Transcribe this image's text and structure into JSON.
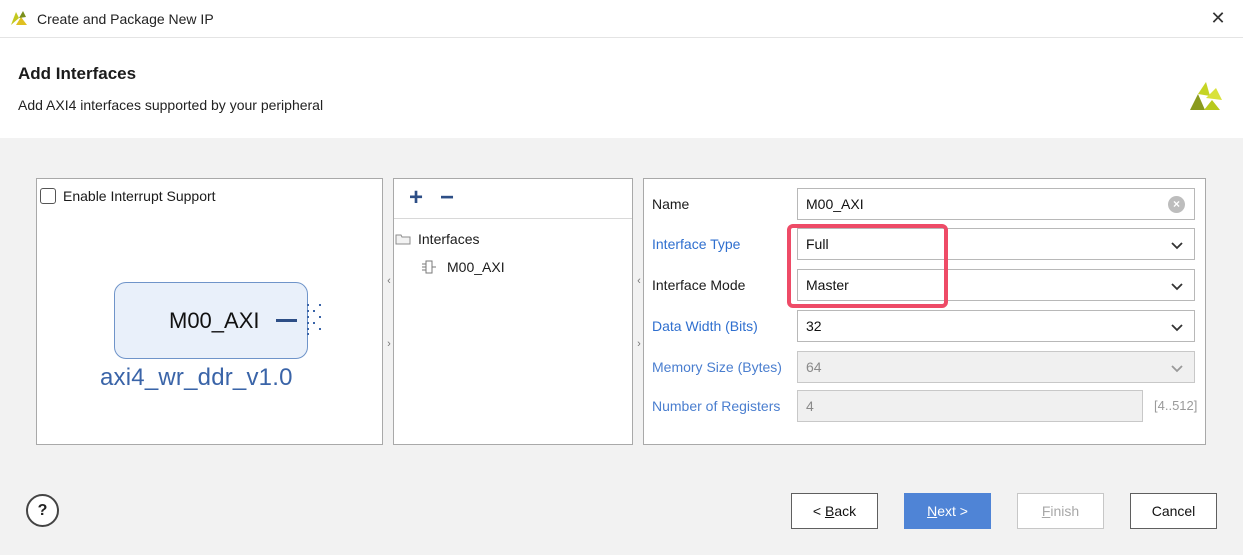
{
  "window": {
    "title": "Create and Package New IP",
    "close_glyph": "✕"
  },
  "header": {
    "title": "Add Interfaces",
    "subtitle": "Add AXI4 interfaces supported by your peripheral"
  },
  "symbol_panel": {
    "interrupt_checkbox_label": "Enable Interrupt Support",
    "interrupt_checked": false,
    "ip_port_label": "M00_AXI",
    "ip_name": "axi4_wr_ddr_v1.0"
  },
  "interface_tree": {
    "add_glyph": "+",
    "remove_glyph": "−",
    "root_label": "Interfaces",
    "items": [
      {
        "label": "M00_AXI"
      }
    ]
  },
  "splitters": {
    "left": "‹",
    "right": "›"
  },
  "properties": {
    "name": {
      "label": "Name",
      "value": "M00_AXI"
    },
    "interface_type": {
      "label": "Interface Type",
      "value": "Full"
    },
    "interface_mode": {
      "label": "Interface Mode",
      "value": "Master"
    },
    "data_width": {
      "label": "Data Width (Bits)",
      "value": "32"
    },
    "memory_size": {
      "label": "Memory Size (Bytes)",
      "value": "64"
    },
    "num_registers": {
      "label": "Number of Registers",
      "value": "4",
      "range": "[4..512]"
    }
  },
  "footer": {
    "help_label": "?",
    "back": {
      "mnemonic": "B",
      "rest": "ack",
      "prefix": "< "
    },
    "next": {
      "mnemonic": "N",
      "rest": "ext >"
    },
    "finish": {
      "mnemonic": "F",
      "rest": "inish"
    },
    "cancel": "Cancel"
  },
  "colors": {
    "accent": "#4f84d6",
    "link": "#2f6fcf",
    "highlight": "#ee4b67",
    "logo": "#b8c91d"
  }
}
